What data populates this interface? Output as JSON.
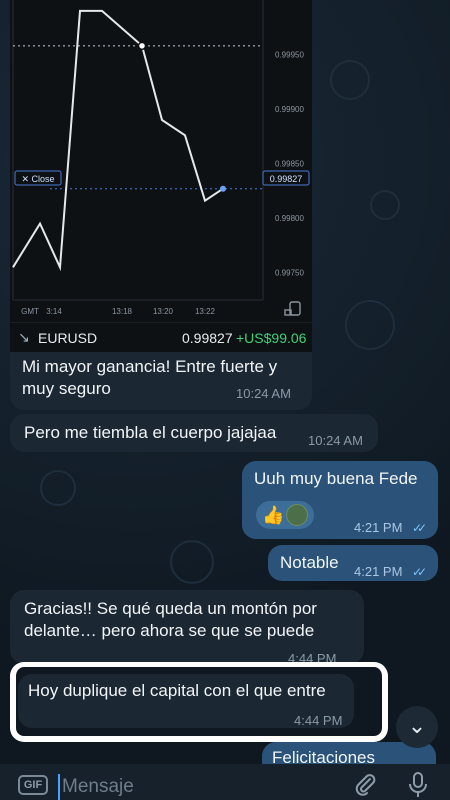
{
  "chart": {
    "price_labels": [
      "0.99950",
      "0.99900",
      "0.99850",
      "0.99800",
      "0.99750"
    ],
    "current_price": "0.99827",
    "close_label": "✕ Close",
    "time_labels": [
      "GMT",
      "3:14",
      "13:18",
      "13:20",
      "13:22"
    ],
    "symbol": "EURUSD",
    "price": "0.99827",
    "gain": "+US$99.06",
    "caption": "Mi mayor ganancia! Entre fuerte y muy seguro",
    "time": "10:24 AM"
  },
  "chart_data": {
    "type": "line",
    "x": [
      "13:14",
      "13:15",
      "13:16",
      "13:17",
      "13:18",
      "13:19",
      "13:20",
      "13:21",
      "13:22",
      "13:23"
    ],
    "series": [
      {
        "values": [
          0.99755,
          0.99795,
          0.99755,
          0.9999,
          0.9999,
          0.99958,
          0.9989,
          0.99876,
          0.99816,
          0.99827
        ]
      }
    ],
    "ylim": [
      0.99725,
      1.0
    ],
    "y_ticks": [
      "0.99950",
      "0.99900",
      "0.99850",
      "0.99800",
      "0.99750"
    ],
    "x_ticks": [
      "GMT",
      "3:14",
      "13:18",
      "13:20",
      "13:22"
    ]
  },
  "messages": [
    {
      "text": "Pero me tiembla el cuerpo jajajaa",
      "time": "10:24 AM",
      "direction": "in"
    },
    {
      "text": "Uuh muy buena Fede",
      "time": "4:21 PM",
      "direction": "out"
    },
    {
      "text": "Notable",
      "time": "4:21 PM",
      "direction": "out"
    },
    {
      "text": "Gracias!! Se qué queda un montón por delante… pero ahora se que se puede",
      "time": "4:44 PM",
      "direction": "in"
    },
    {
      "text": "Hoy duplique el capital con el que entre",
      "time": "4:44 PM",
      "direction": "in"
    },
    {
      "text": "Felicitaciones",
      "direction": "out"
    }
  ],
  "reactions": {
    "emoji": "👍",
    "emoji_icon": "thumbs-up-icon"
  },
  "read_ticks": "✓✓",
  "composer": {
    "gif_label": "GIF",
    "placeholder": "Mensaje"
  },
  "scroll_down_glyph": "⌄",
  "colors": {
    "background": "#101a24",
    "incoming": "#1b2733",
    "outgoing": "#2b5278",
    "gain_green": "#3fd07a",
    "tick_blue": "#7cc4ff"
  }
}
